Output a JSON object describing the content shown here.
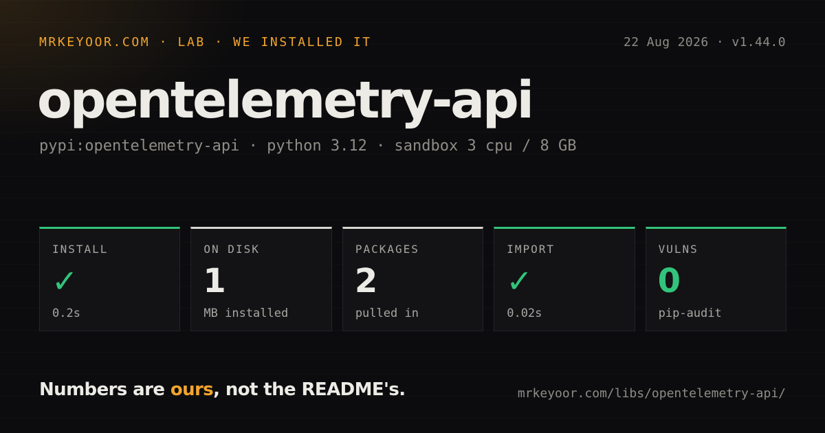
{
  "header": {
    "kicker": "MRKEYOOR.COM · LAB · WE INSTALLED IT",
    "meta": "22 Aug 2026 · v1.44.0"
  },
  "package": {
    "name": "opentelemetry-api",
    "subtitle": "pypi:opentelemetry-api · python 3.12 · sandbox 3 cpu / 8 GB"
  },
  "stats": [
    {
      "label": "INSTALL",
      "value": "✓",
      "note": "0.2s",
      "accent_color": "#32c47a"
    },
    {
      "label": "ON DISK",
      "value": "1",
      "note": "MB installed",
      "accent_color": "#d8d6d0"
    },
    {
      "label": "PACKAGES",
      "value": "2",
      "note": "pulled in",
      "accent_color": "#d8d6d0"
    },
    {
      "label": "IMPORT",
      "value": "✓",
      "note": "0.02s",
      "accent_color": "#32c47a"
    },
    {
      "label": "VULNS",
      "value": "0",
      "note": "pip-audit",
      "accent_color": "#32c47a"
    }
  ],
  "footer": {
    "tagline_before": "Numbers are ",
    "tagline_accent": "ours",
    "tagline_after": ", not the README's.",
    "url": "mrkeyoor.com/libs/opentelemetry-api/"
  },
  "colors": {
    "brand_accent": "#f2a52e",
    "success": "#32c47a",
    "background": "#0c0c0e"
  }
}
